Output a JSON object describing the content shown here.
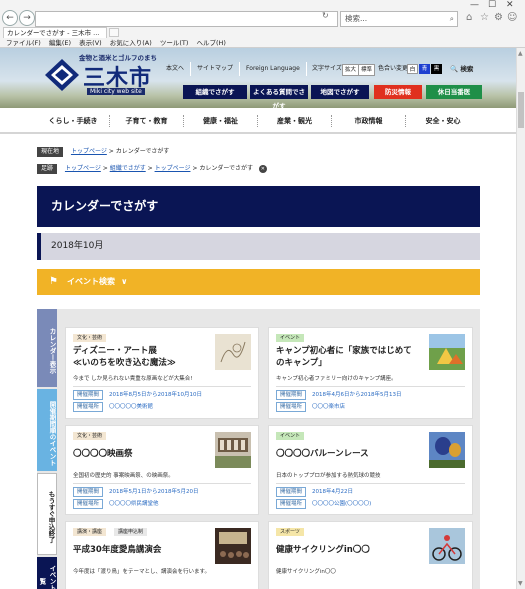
{
  "browser": {
    "address": "",
    "search_placeholder": "検索...",
    "tab_title": "カレンダーでさがす - 三木市 ...",
    "menu": [
      "ファイル(F)",
      "編集(E)",
      "表示(V)",
      "お気に入り(A)",
      "ツール(T)",
      "ヘルプ(H)"
    ]
  },
  "header": {
    "logo_tagline": "金物と酒米とゴルフのまち",
    "logo_name": "三木市",
    "logo_en": "Miki city web site",
    "util_links": [
      "本文へ",
      "サイトマップ",
      "Foreign Language"
    ],
    "font_size_label": "文字サイズ",
    "font_sizes": [
      "拡大",
      "標準"
    ],
    "color_label": "色合い変更",
    "color_options": [
      "白",
      "青",
      "黒"
    ],
    "search_label": "検索",
    "nav_buttons": [
      {
        "label": "組織でさがす",
        "color": "#0a1554"
      },
      {
        "label": "よくある質問でさがす",
        "color": "#0a1554"
      },
      {
        "label": "地図でさがす",
        "color": "#0a1554"
      },
      {
        "label": "防災情報",
        "color": "#e0301e"
      },
      {
        "label": "休日当番医",
        "color": "#1f8f48"
      }
    ]
  },
  "global_nav": [
    "くらし・手続き",
    "子育て・教育",
    "健康・福祉",
    "産業・観光",
    "市政情報",
    "安全・安心"
  ],
  "breadcrumb_current": {
    "tag": "現在地",
    "items": [
      "トップページ",
      "カレンダーでさがす"
    ]
  },
  "breadcrumb_history": {
    "tag": "足跡",
    "items": [
      "トップページ",
      "組織でさがす",
      "トップページ",
      "カレンダーでさがす"
    ]
  },
  "page_title": "カレンダーでさがす",
  "month": "2018年10月",
  "event_search_label": "イベント検索",
  "side_tabs": [
    {
      "label": "カレンダー表示",
      "color": "#7a8ab8"
    },
    {
      "label": "開催期間順のイベント",
      "color": "#69b3e2"
    },
    {
      "label": "もうすぐ申込終了",
      "color": "#ffffff"
    },
    {
      "label": "イベント一覧",
      "color": "#0a1554"
    }
  ],
  "cards": [
    {
      "category": "文化・芸術",
      "category_color": "#f3e6d2",
      "title": "ディズニー・アート展\n≪いのちを吹き込む魔法≫",
      "desc": "今まで しか見られない貴重な原画などが大集合!",
      "period_label": "開催期間",
      "period": "2018年8月5日から2018年10月10日",
      "place_label": "開催場所",
      "place": "〇〇〇〇〇美術館"
    },
    {
      "category": "イベント",
      "category_color": "#c5e7b9",
      "title": "キャンプ初心者に「家族ではじめて\nのキャンプ」",
      "desc": "キャンプ初心者ファミリー向けのキャンプ講座。",
      "period_label": "開催期間",
      "period": "2018年4月6日から2018年5月13日",
      "place_label": "開催場所",
      "place": "〇〇〇楽市店"
    },
    {
      "category": "文化・芸術",
      "category_color": "#f3e6d2",
      "title": "〇〇〇〇映画祭",
      "desc": "全国初の歴史的 事案映画祭、の映画祭。",
      "period_label": "開催期間",
      "period": "2018年5月1日から2018年5月20日",
      "place_label": "開催場所",
      "place": "〇〇〇〇県民講堂他"
    },
    {
      "category": "イベント",
      "category_color": "#c5e7b9",
      "title": "〇〇〇〇バルーンレース",
      "desc": "日本のトッププロが参加する熱気球の競技",
      "period_label": "開催期間",
      "period": "2018年4月22日",
      "place_label": "開催場所",
      "place": "〇〇〇〇公園(〇〇〇〇)"
    },
    {
      "category": "講演・講座",
      "category_color": "#f3e6d2",
      "category2": "講座申込制",
      "title": "平成30年度愛鳥講演会",
      "desc": "今年度は「渡り鳥」をテーマとし、講演会を行います。",
      "period_label": "",
      "period": "",
      "place_label": "",
      "place": ""
    },
    {
      "category": "スポーツ",
      "category_color": "#f5e6a8",
      "title": "健康サイクリングin〇〇",
      "desc": "健康サイクリングin〇〇",
      "period_label": "",
      "period": "",
      "place_label": "",
      "place": ""
    }
  ],
  "colors": {
    "navy": "#0a1554",
    "accent_yellow": "#f1b326",
    "link_blue": "#2a6bc2"
  }
}
